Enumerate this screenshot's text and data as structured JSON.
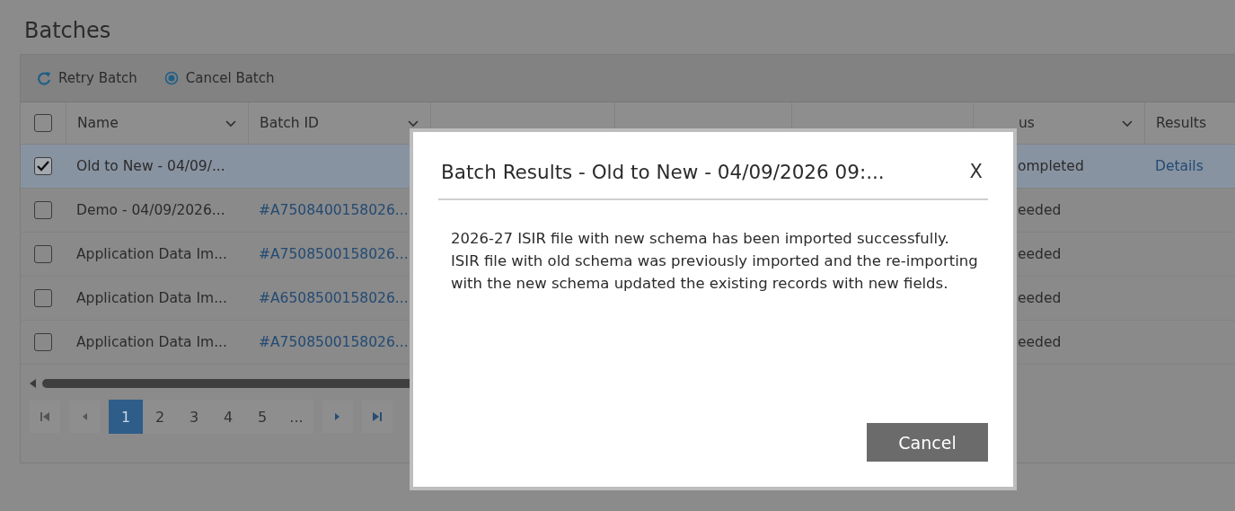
{
  "page": {
    "title": "Batches"
  },
  "toolbar": [
    {
      "kind": "retry",
      "label": "Retry Batch"
    },
    {
      "kind": "cancel",
      "label": "Cancel Batch"
    }
  ],
  "table": {
    "all_checked": false,
    "columns": [
      {
        "label": "Name",
        "sortable": true
      },
      {
        "label": "Batch ID",
        "sortable": true
      },
      {},
      {},
      {},
      {
        "label": "us",
        "sortable": true
      },
      {
        "label": "Results",
        "sortable": false
      }
    ],
    "rows": [
      {
        "selected": true,
        "checked": true,
        "name": "Old to New - 04/09/...",
        "status": "ompleted",
        "results": "Details"
      },
      {
        "selected": false,
        "checked": false,
        "name": "Demo - 04/09/2026...",
        "batch_id": "#A7508400158026...",
        "status": "eeded"
      },
      {
        "selected": false,
        "checked": false,
        "name": "Application Data Im...",
        "batch_id": "#A7508500158026...",
        "status": "eeded"
      },
      {
        "selected": false,
        "checked": false,
        "name": "Application Data Im...",
        "batch_id": "#A6508500158026...",
        "status": "eeded"
      },
      {
        "selected": false,
        "checked": false,
        "name": "Application Data Im...",
        "batch_id": "#A7508500158026...",
        "status": "eeded"
      }
    ]
  },
  "pager": {
    "pages": [
      {
        "label": "1",
        "selected": true
      },
      {
        "label": "2",
        "selected": false
      },
      {
        "label": "3",
        "selected": false
      },
      {
        "label": "4",
        "selected": false
      },
      {
        "label": "5",
        "selected": false
      },
      {
        "label": "...",
        "selected": false
      }
    ]
  },
  "dialog": {
    "title": "Batch Results - Old to New - 04/09/2026 09:...",
    "close": "X",
    "message": "2026-27 ISIR file with new schema has been imported successfully. ISIR file with old schema was previously imported and the re-importing with the new schema updated the existing records with new fields.",
    "buttons": [
      "Cancel"
    ]
  }
}
